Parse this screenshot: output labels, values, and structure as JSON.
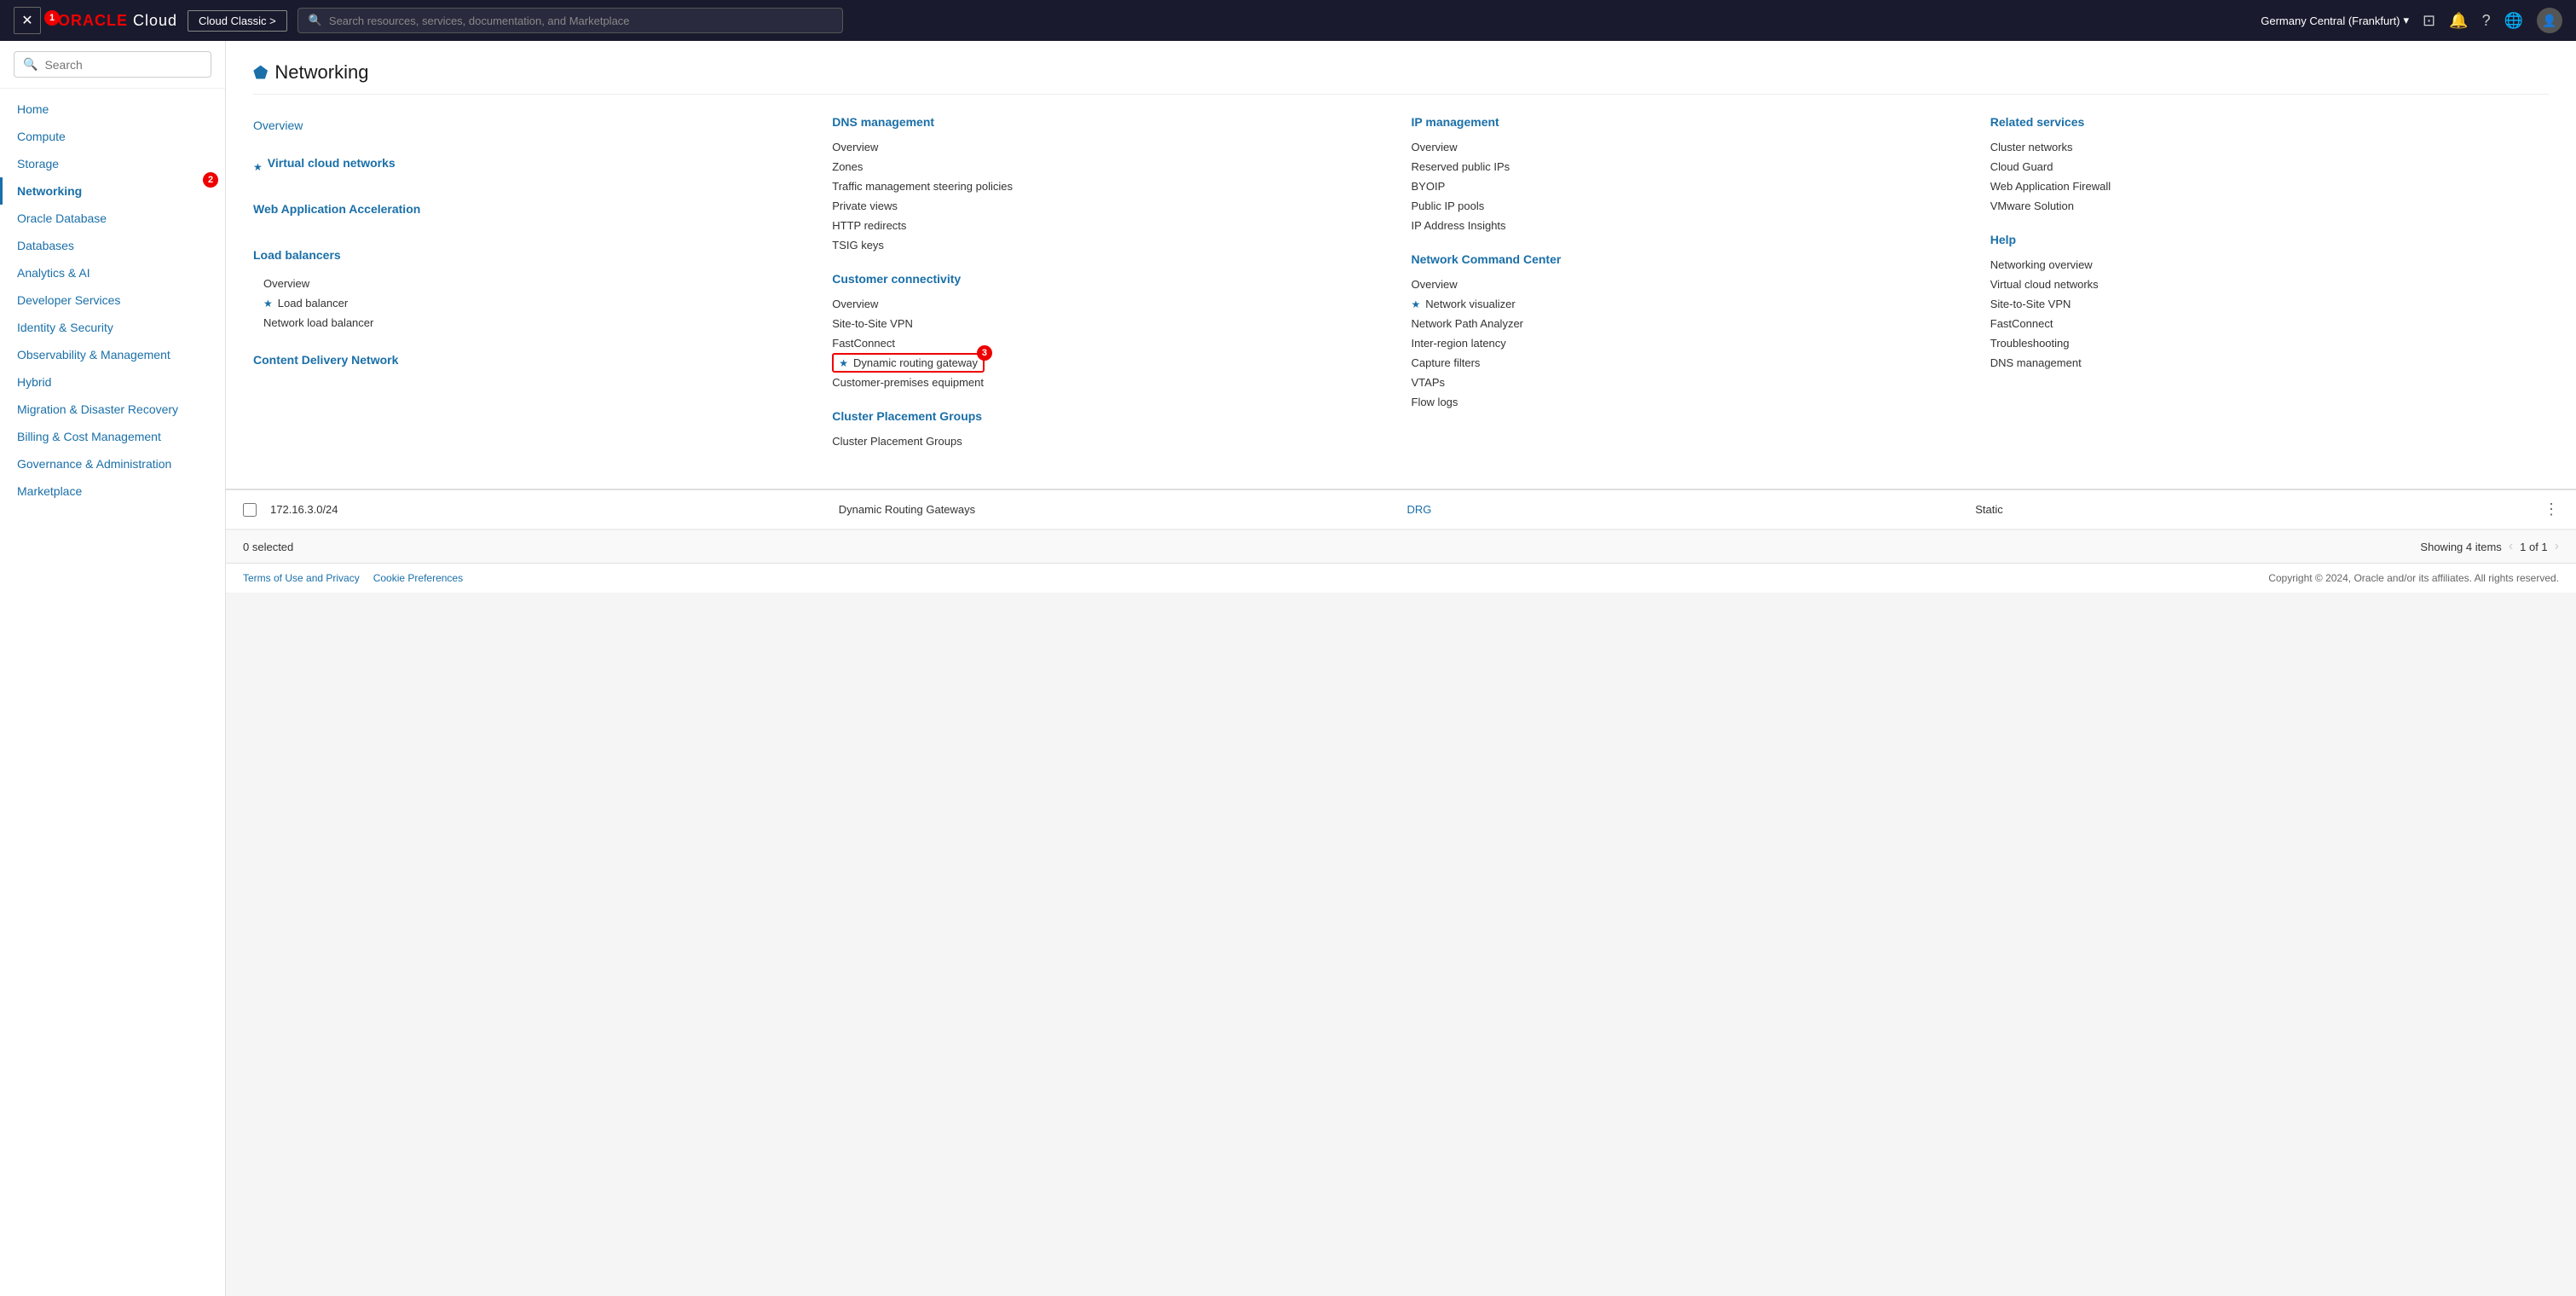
{
  "topnav": {
    "close_label": "✕",
    "badge1": "1",
    "logo": "ORACLE Cloud",
    "oracle_text": "ORACLE",
    "cloud_text": "Cloud",
    "cloud_classic": "Cloud Classic >",
    "search_placeholder": "Search resources, services, documentation, and Marketplace",
    "region": "Germany Central (Frankfurt)",
    "nav_icons": [
      "monitor",
      "bell",
      "question",
      "globe",
      "user"
    ]
  },
  "sidebar": {
    "search_placeholder": "Search",
    "items": [
      {
        "label": "Home",
        "active": false
      },
      {
        "label": "Compute",
        "active": false
      },
      {
        "label": "Storage",
        "active": false
      },
      {
        "label": "Networking",
        "active": true
      },
      {
        "label": "Oracle Database",
        "active": false
      },
      {
        "label": "Databases",
        "active": false
      },
      {
        "label": "Analytics & AI",
        "active": false
      },
      {
        "label": "Developer Services",
        "active": false
      },
      {
        "label": "Identity & Security",
        "active": false
      },
      {
        "label": "Observability & Management",
        "active": false
      },
      {
        "label": "Hybrid",
        "active": false
      },
      {
        "label": "Migration & Disaster Recovery",
        "active": false
      },
      {
        "label": "Billing & Cost Management",
        "active": false
      },
      {
        "label": "Governance & Administration",
        "active": false
      },
      {
        "label": "Marketplace",
        "active": false
      }
    ],
    "badge2": "2"
  },
  "megamenu": {
    "title": "Networking",
    "icon": "🔗",
    "overview": "Overview",
    "col1": {
      "items": [
        {
          "label": "Virtual cloud networks",
          "starred": true
        },
        {
          "label": "Web Application Acceleration",
          "link": true
        },
        {
          "label": "Load balancers",
          "link": true
        },
        {
          "label": "Overview",
          "sub": true
        },
        {
          "label": "Load balancer",
          "starred": true,
          "sub": true
        },
        {
          "label": "Network load balancer",
          "sub": true
        },
        {
          "label": "Content Delivery Network",
          "link": true
        }
      ]
    },
    "col2": {
      "title": "DNS management",
      "items": [
        {
          "label": "Overview"
        },
        {
          "label": "Zones"
        },
        {
          "label": "Traffic management steering policies"
        },
        {
          "label": "Private views"
        },
        {
          "label": "HTTP redirects"
        },
        {
          "label": "TSIG keys"
        }
      ],
      "section2_title": "Customer connectivity",
      "section2_items": [
        {
          "label": "Overview"
        },
        {
          "label": "Site-to-Site VPN"
        },
        {
          "label": "FastConnect"
        },
        {
          "label": "Dynamic routing gateway",
          "starred": true,
          "highlighted": true,
          "badge": "3"
        },
        {
          "label": "Customer-premises equipment"
        }
      ],
      "section3_title": "Cluster Placement Groups",
      "section3_items": [
        {
          "label": "Cluster Placement Groups"
        }
      ]
    },
    "col3": {
      "title": "IP management",
      "items": [
        {
          "label": "Overview"
        },
        {
          "label": "Reserved public IPs"
        },
        {
          "label": "BYOIP"
        },
        {
          "label": "Public IP pools"
        },
        {
          "label": "IP Address Insights"
        }
      ],
      "section2_title": "Network Command Center",
      "section2_items": [
        {
          "label": "Overview"
        },
        {
          "label": "Network visualizer",
          "starred": true
        },
        {
          "label": "Network Path Analyzer"
        },
        {
          "label": "Inter-region latency"
        },
        {
          "label": "Capture filters"
        },
        {
          "label": "VTAPs"
        },
        {
          "label": "Flow logs"
        }
      ]
    },
    "col4": {
      "title": "Related services",
      "items": [
        {
          "label": "Cluster networks"
        },
        {
          "label": "Cloud Guard"
        },
        {
          "label": "Web Application Firewall"
        },
        {
          "label": "VMware Solution"
        }
      ],
      "help_title": "Help",
      "help_items": [
        {
          "label": "Networking overview"
        },
        {
          "label": "Virtual cloud networks"
        },
        {
          "label": "Site-to-Site VPN"
        },
        {
          "label": "FastConnect"
        },
        {
          "label": "Troubleshooting"
        },
        {
          "label": "DNS management"
        }
      ]
    }
  },
  "table": {
    "row": {
      "cidr": "172.16.3.0/24",
      "gateway_type": "Dynamic Routing Gateways",
      "target": "DRG",
      "route_type": "Static"
    },
    "footer": {
      "selected": "0 selected",
      "showing": "Showing 4 items",
      "pages": "1 of 1"
    }
  },
  "footer": {
    "terms": "Terms of Use and Privacy",
    "cookies": "Cookie Preferences",
    "copyright": "Copyright © 2024, Oracle and/or its affiliates. All rights reserved."
  }
}
